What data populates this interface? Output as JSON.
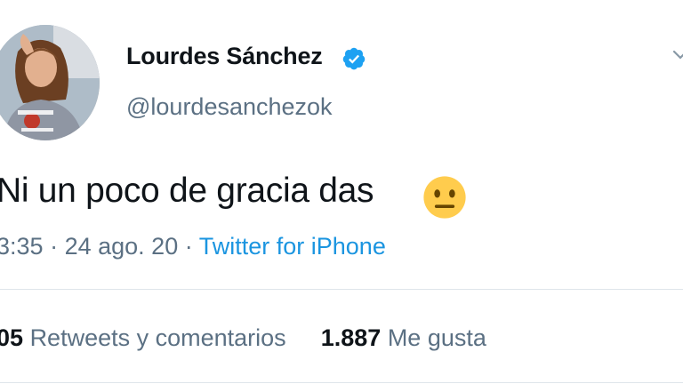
{
  "tweet": {
    "author": {
      "display_name": "Lourdes Sánchez",
      "handle": "@lourdesanchezok",
      "verified": true,
      "avatar": "profile-photo"
    },
    "text": "Ni un poco de gracia das",
    "emoji": "neutral-face-emoji",
    "time": "3:35",
    "separator": "·",
    "date": "24 ago. 20",
    "source": "Twitter for iPhone",
    "stats": {
      "retweets_count": "05",
      "retweets_label": "Retweets y comentarios",
      "likes_count": "1.887",
      "likes_label": "Me gusta"
    }
  },
  "colors": {
    "link": "#1b95e0",
    "secondary_text": "#5b7083",
    "primary_text": "#0f1419",
    "verified_badge": "#1da1f2",
    "divider": "#dfe5ea",
    "emoji_fill": "#ffcc4d"
  },
  "icons": [
    "verified-badge-icon",
    "chevron-down-icon",
    "neutral-face-emoji"
  ]
}
